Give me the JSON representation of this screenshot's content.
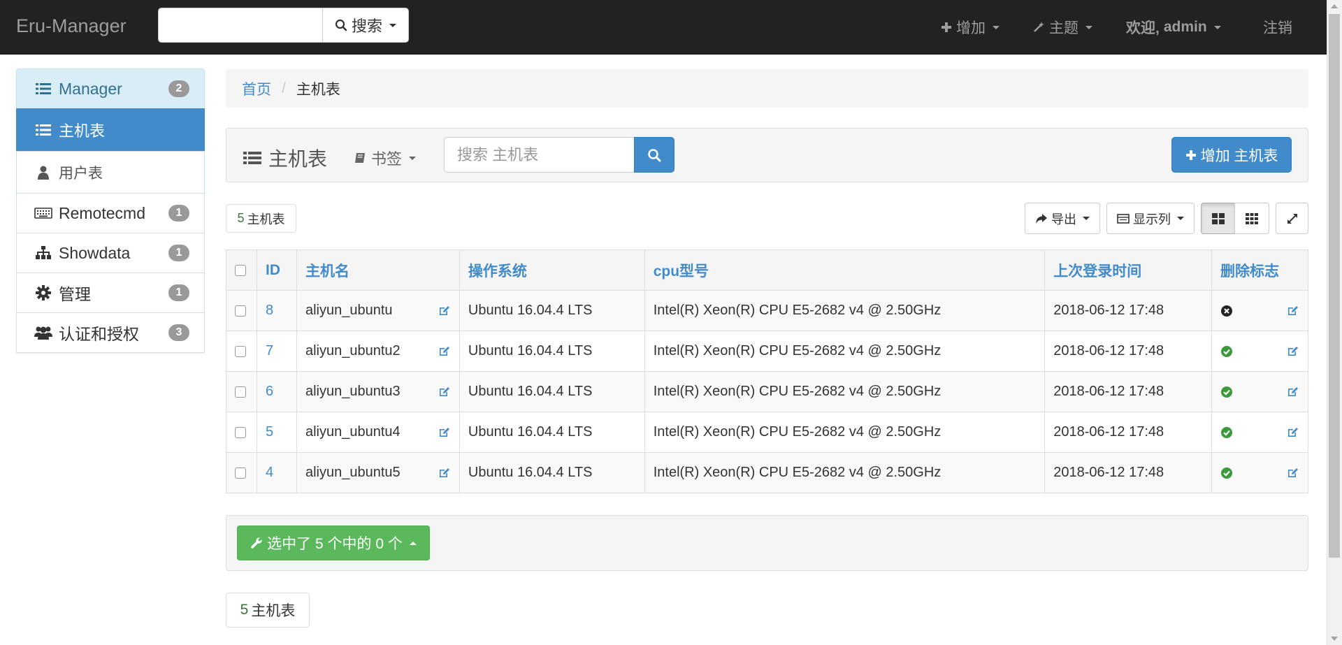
{
  "navbar": {
    "brand": "Eru-Manager",
    "search_btn": "搜索",
    "add": "增加",
    "theme": "主题",
    "welcome": "欢迎,",
    "user": "admin",
    "logout": "注销"
  },
  "sidebar": {
    "items": [
      {
        "label": "Manager",
        "badge": "2",
        "icon": "list-icon"
      },
      {
        "label": "主机表",
        "icon": "list-icon"
      },
      {
        "label": "用户表",
        "icon": "user-icon"
      },
      {
        "label": "Remotecmd",
        "badge": "1",
        "icon": "keyboard-icon"
      },
      {
        "label": "Showdata",
        "badge": "1",
        "icon": "sitemap-icon"
      },
      {
        "label": "管理",
        "badge": "1",
        "icon": "gear-icon"
      },
      {
        "label": "认证和授权",
        "badge": "3",
        "icon": "users-icon"
      }
    ]
  },
  "breadcrumb": {
    "home": "首页",
    "current": "主机表"
  },
  "panel": {
    "title": "主机表",
    "bookmark": "书签",
    "search_placeholder": "搜索 主机表",
    "add_button": "增加 主机表"
  },
  "toolbar": {
    "count_num": "5",
    "count_label": "主机表",
    "export": "导出",
    "columns": "显示列"
  },
  "table": {
    "headers": [
      "ID",
      "主机名",
      "操作系统",
      "cpu型号",
      "上次登录时间",
      "删除标志"
    ],
    "rows": [
      {
        "id": "8",
        "hostname": "aliyun_ubuntu",
        "os": "Ubuntu 16.04.4 LTS",
        "cpu": "Intel(R) Xeon(R) CPU E5-2682 v4 @ 2.50GHz",
        "last_login": "2018-06-12 17:48",
        "deleted": true
      },
      {
        "id": "7",
        "hostname": "aliyun_ubuntu2",
        "os": "Ubuntu 16.04.4 LTS",
        "cpu": "Intel(R) Xeon(R) CPU E5-2682 v4 @ 2.50GHz",
        "last_login": "2018-06-12 17:48",
        "deleted": false
      },
      {
        "id": "6",
        "hostname": "aliyun_ubuntu3",
        "os": "Ubuntu 16.04.4 LTS",
        "cpu": "Intel(R) Xeon(R) CPU E5-2682 v4 @ 2.50GHz",
        "last_login": "2018-06-12 17:48",
        "deleted": false
      },
      {
        "id": "5",
        "hostname": "aliyun_ubuntu4",
        "os": "Ubuntu 16.04.4 LTS",
        "cpu": "Intel(R) Xeon(R) CPU E5-2682 v4 @ 2.50GHz",
        "last_login": "2018-06-12 17:48",
        "deleted": false
      },
      {
        "id": "4",
        "hostname": "aliyun_ubuntu5",
        "os": "Ubuntu 16.04.4 LTS",
        "cpu": "Intel(R) Xeon(R) CPU E5-2682 v4 @ 2.50GHz",
        "last_login": "2018-06-12 17:48",
        "deleted": false
      }
    ]
  },
  "actions": {
    "selected_label": "选中了 5 个中的 0 个"
  },
  "footer_count": {
    "num": "5",
    "label": "主机表"
  },
  "colors": {
    "primary": "#428bca",
    "success": "#5cb85c",
    "navbar": "#222222",
    "check_green": "#3a9a3a"
  }
}
